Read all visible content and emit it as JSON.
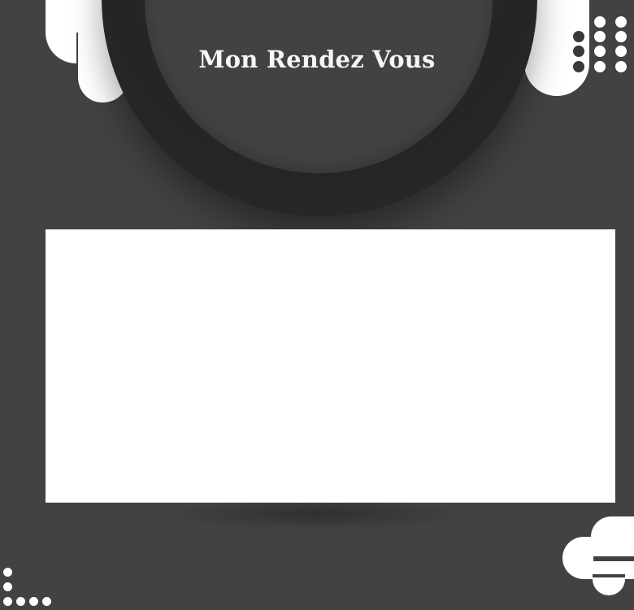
{
  "header": {
    "title": "Mon Rendez Vous"
  },
  "colors": {
    "background": "#434142",
    "ring": "#262425",
    "panel": "#ffffff",
    "accent_shapes": "#ffffff"
  }
}
